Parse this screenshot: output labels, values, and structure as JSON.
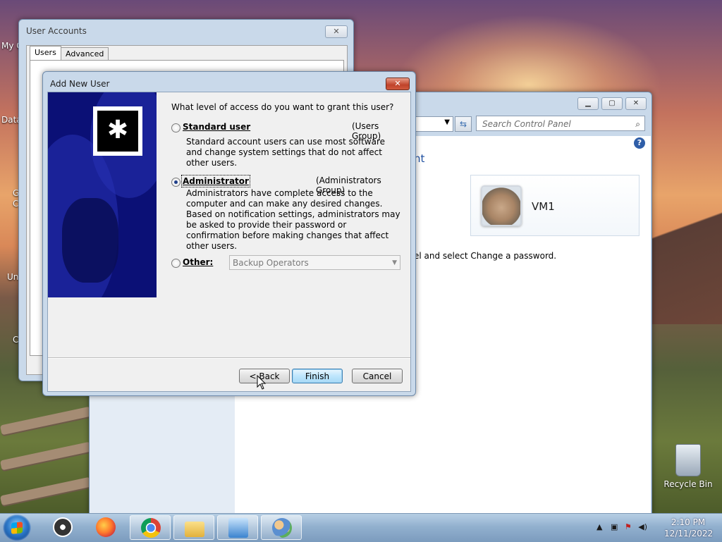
{
  "background_window": {
    "title": "User Accounts",
    "tabs": [
      {
        "label": "Users"
      },
      {
        "label": "Advanced"
      }
    ]
  },
  "control_panel": {
    "search_placeholder": "Search Control Panel",
    "heading_fragment": "nt",
    "user_card_name": "VM1",
    "help_text_fragment": "el and select Change a password."
  },
  "dialog": {
    "title": "Add New User",
    "question": "What level of access do you want to grant this user?",
    "options": [
      {
        "label": "Standard user",
        "group": "(Users Group)",
        "selected": false,
        "description": "Standard account users can use most software and change system settings that do not affect other users."
      },
      {
        "label": "Administrator",
        "group": "(Administrators Group)",
        "selected": true,
        "description": "Administrators have complete access to the computer and can make any desired changes. Based on notification settings, administrators may be asked to provide their password or confirmation before making changes that affect other users."
      },
      {
        "label": "Other:",
        "selected": false
      }
    ],
    "other_select_value": "Backup Operators",
    "buttons": {
      "back": "< Back",
      "finish": "Finish",
      "cancel": "Cancel"
    }
  },
  "desktop": {
    "icon_fragments": [
      "My C",
      "Data",
      "G",
      "C",
      "Un",
      "C"
    ],
    "recycle_bin_label": "Recycle Bin"
  },
  "taskbar": {
    "time": "2:10 PM",
    "date": "12/11/2022"
  },
  "colors": {
    "dialog_banner": "#0b1076",
    "title_bar": "#c9d9ea",
    "close_button": "#c0432a",
    "default_button": "#bee6fd"
  },
  "icons": [
    "start-orb-icon",
    "obs-icon",
    "firefox-icon",
    "chrome-icon",
    "folder-icon",
    "control-panel-icon",
    "users-icon",
    "keyboard-key-icon",
    "search-icon",
    "help-icon",
    "recycle-bin-icon"
  ]
}
